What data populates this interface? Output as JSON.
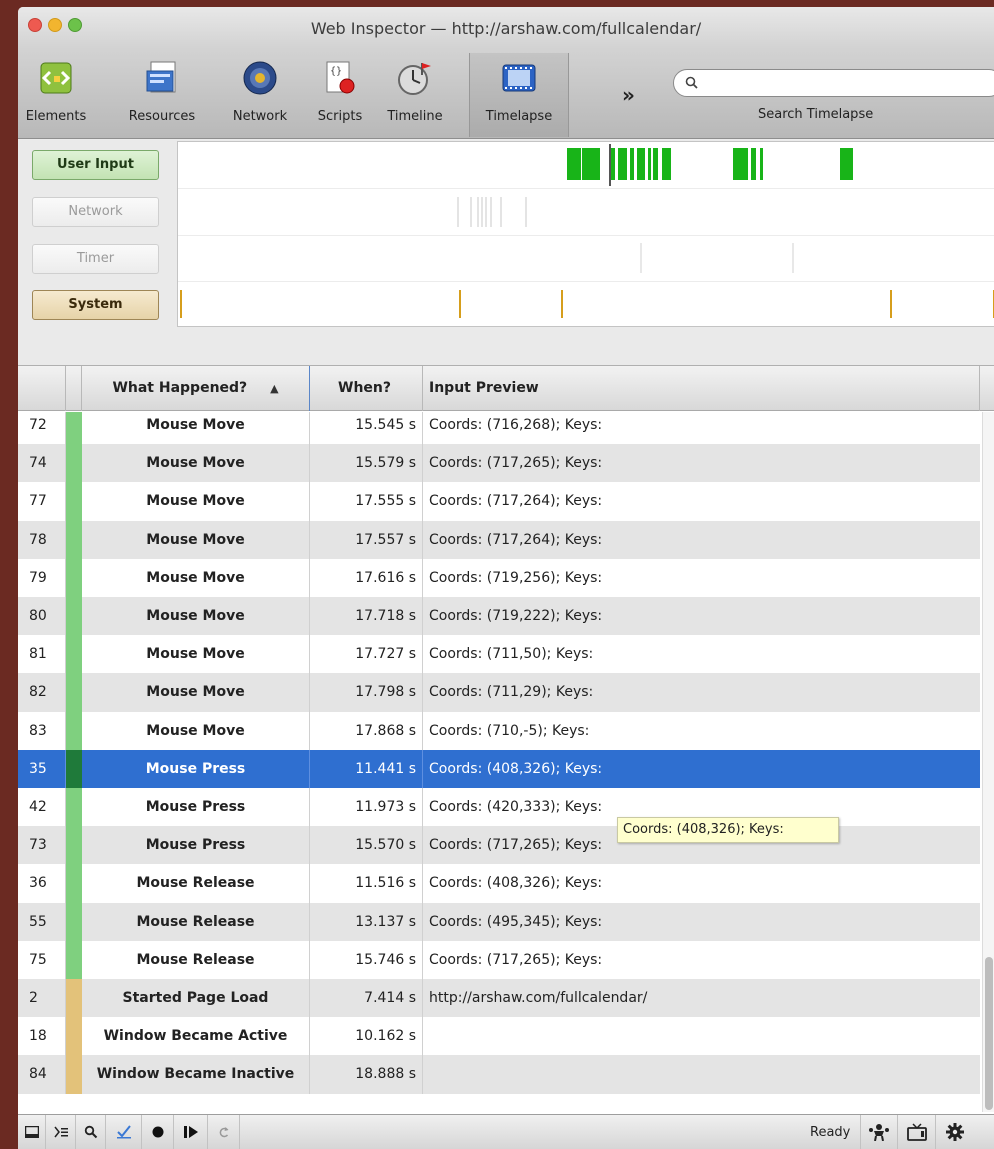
{
  "window": {
    "title": "Web Inspector — http://arshaw.com/fullcalendar/"
  },
  "toolbar": {
    "items": [
      {
        "label": "Elements",
        "icon": "elements-icon"
      },
      {
        "label": "Resources",
        "icon": "resources-icon"
      },
      {
        "label": "Network",
        "icon": "network-icon"
      },
      {
        "label": "Scripts",
        "icon": "scripts-icon"
      },
      {
        "label": "Timeline",
        "icon": "timeline-icon"
      },
      {
        "label": "Timelapse",
        "icon": "timelapse-icon",
        "selected": true
      }
    ],
    "overflow": "»",
    "search_label": "Search Timelapse",
    "search_value": ""
  },
  "filters": [
    {
      "label": "User Input",
      "active": true,
      "color": "#2ca02c"
    },
    {
      "label": "Network",
      "active": false,
      "color": "#bdbdbd"
    },
    {
      "label": "Timer",
      "active": false,
      "color": "#bdbdbd"
    },
    {
      "label": "System",
      "active": true,
      "color": "#d69e1c"
    }
  ],
  "table": {
    "columns": {
      "what": "What Happened?",
      "when": "When?",
      "preview": "Input Preview"
    },
    "sort_indicator": "▲",
    "rows": [
      {
        "id": "72",
        "what": "Mouse Move",
        "when": "15.545 s",
        "preview": "Coords: (716,268); Keys:",
        "kind": "input"
      },
      {
        "id": "74",
        "what": "Mouse Move",
        "when": "15.579 s",
        "preview": "Coords: (717,265); Keys:",
        "kind": "input"
      },
      {
        "id": "77",
        "what": "Mouse Move",
        "when": "17.555 s",
        "preview": "Coords: (717,264); Keys:",
        "kind": "input"
      },
      {
        "id": "78",
        "what": "Mouse Move",
        "when": "17.557 s",
        "preview": "Coords: (717,264); Keys:",
        "kind": "input"
      },
      {
        "id": "79",
        "what": "Mouse Move",
        "when": "17.616 s",
        "preview": "Coords: (719,256); Keys:",
        "kind": "input"
      },
      {
        "id": "80",
        "what": "Mouse Move",
        "when": "17.718 s",
        "preview": "Coords: (719,222); Keys:",
        "kind": "input"
      },
      {
        "id": "81",
        "what": "Mouse Move",
        "when": "17.727 s",
        "preview": "Coords: (711,50); Keys:",
        "kind": "input"
      },
      {
        "id": "82",
        "what": "Mouse Move",
        "when": "17.798 s",
        "preview": "Coords: (711,29); Keys:",
        "kind": "input"
      },
      {
        "id": "83",
        "what": "Mouse Move",
        "when": "17.868 s",
        "preview": "Coords: (710,-5); Keys:",
        "kind": "input"
      },
      {
        "id": "35",
        "what": "Mouse Press",
        "when": "11.441 s",
        "preview": "Coords: (408,326); Keys:",
        "kind": "input",
        "selected": true
      },
      {
        "id": "42",
        "what": "Mouse Press",
        "when": "11.973 s",
        "preview": "Coords: (420,333); Keys:",
        "kind": "input"
      },
      {
        "id": "73",
        "what": "Mouse Press",
        "when": "15.570 s",
        "preview": "Coords: (717,265); Keys:",
        "kind": "input"
      },
      {
        "id": "36",
        "what": "Mouse Release",
        "when": "11.516 s",
        "preview": "Coords: (408,326); Keys:",
        "kind": "input"
      },
      {
        "id": "55",
        "what": "Mouse Release",
        "when": "13.137 s",
        "preview": "Coords: (495,345); Keys:",
        "kind": "input"
      },
      {
        "id": "75",
        "what": "Mouse Release",
        "when": "15.746 s",
        "preview": "Coords: (717,265); Keys:",
        "kind": "input"
      },
      {
        "id": "2",
        "what": "Started Page Load",
        "when": "7.414 s",
        "preview": "http://arshaw.com/fullcalendar/",
        "kind": "system"
      },
      {
        "id": "18",
        "what": "Window Became Active",
        "when": "10.162 s",
        "preview": "",
        "kind": "system"
      },
      {
        "id": "84",
        "what": "Window Became Inactive",
        "when": "18.888 s",
        "preview": "",
        "kind": "system"
      }
    ]
  },
  "tooltip": "Coords: (408,326); Keys:",
  "status": {
    "ready": "Ready"
  },
  "statusbar_icons": [
    "dock-icon",
    "console-icon",
    "search-icon",
    "checkmark-icon",
    "record-icon",
    "step-icon",
    "reload-icon"
  ],
  "colors": {
    "input": "#7fd07f",
    "system": "#e3c27a",
    "selection": "#2f6fd0"
  }
}
